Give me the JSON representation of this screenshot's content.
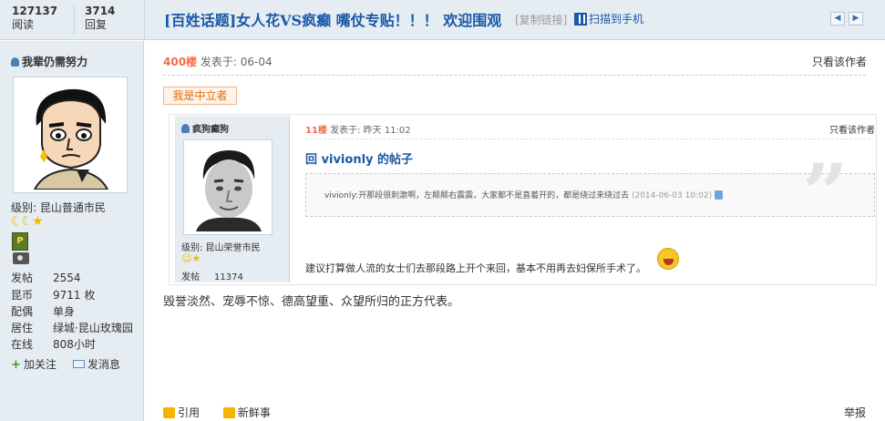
{
  "stats": {
    "views_value": "127137",
    "views_label": "阅读",
    "replies_value": "3714",
    "replies_label": "回复"
  },
  "thread": {
    "title": "[百姓话题]女人花VS疯癫 嘴仗专贴！！！ 欢迎围观",
    "copy_link": "[复制链接]",
    "scan_phone": "扫描到手机"
  },
  "author": {
    "name": "我辈仍需努力",
    "level": "级别: 昆山普通市民",
    "stars": "☾☾★",
    "medal_letter": "P",
    "stats": [
      {
        "key": "发帖",
        "value": "2554"
      },
      {
        "key": "昆币",
        "value": "9711 枚"
      },
      {
        "key": "配偶",
        "value": "单身"
      },
      {
        "key": "居住",
        "value": "绿城·昆山玫瑰园"
      },
      {
        "key": "在线",
        "value": "808小时"
      }
    ],
    "follow": "加关注",
    "message": "发消息"
  },
  "post": {
    "floor": "400楼",
    "posted": "发表于: 06-04",
    "only_author": "只看该作者",
    "tag": "我是中立者",
    "body": "毁誉淡然、宠辱不惊、德高望重、众望所归的正方代表。",
    "actions": {
      "quote": "引用",
      "fresh": "新鲜事",
      "report": "举报"
    }
  },
  "quoted_post": {
    "author": "疯狗癫狗",
    "level": "级别: 昆山荣誉市民",
    "stars": "☺★",
    "posts_key": "发帖",
    "posts_value": "11374",
    "floor": "11楼",
    "posted": "发表于: 昨天 11:02",
    "only_author": "只看该作者",
    "reply_title": "回 vivionly 的帖子",
    "quote_text": "vivionly:开那段很刺激啊，左颠颠右震震，大家都不是直着开的，都是绕过来绕过去",
    "quote_time": "(2014-06-03 10:02)",
    "body": "建议打算做人流的女士们去那段路上开个来回，基本不用再去妇保所手术了。"
  },
  "colors": {
    "link": "#1b58a6",
    "floor": "#f26c4f",
    "sidebar": "#e5edf2"
  }
}
